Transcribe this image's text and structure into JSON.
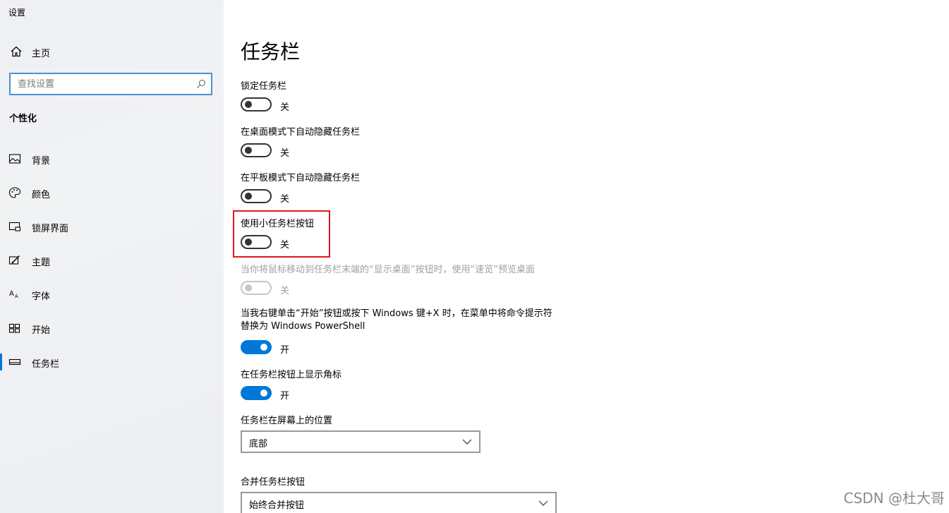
{
  "app": {
    "title": "设置"
  },
  "sidebar": {
    "home_label": "主页",
    "search_placeholder": "查找设置",
    "section_title": "个性化",
    "items": [
      {
        "label": "背景",
        "icon": "image-icon",
        "active": false
      },
      {
        "label": "颜色",
        "icon": "palette-icon",
        "active": false
      },
      {
        "label": "锁屏界面",
        "icon": "lock-screen-icon",
        "active": false
      },
      {
        "label": "主题",
        "icon": "theme-brush-icon",
        "active": false
      },
      {
        "label": "字体",
        "icon": "font-icon",
        "active": false
      },
      {
        "label": "开始",
        "icon": "start-grid-icon",
        "active": false
      },
      {
        "label": "任务栏",
        "icon": "taskbar-icon",
        "active": true
      }
    ]
  },
  "main": {
    "title": "任务栏",
    "settings": [
      {
        "label": "锁定任务栏",
        "state": "关",
        "on": false,
        "disabled": false
      },
      {
        "label": "在桌面模式下自动隐藏任务栏",
        "state": "关",
        "on": false,
        "disabled": false
      },
      {
        "label": "在平板模式下自动隐藏任务栏",
        "state": "关",
        "on": false,
        "disabled": false
      },
      {
        "label": "使用小任务栏按钮",
        "state": "关",
        "on": false,
        "disabled": false
      },
      {
        "label": "当你将鼠标移动到任务栏末端的“显示桌面”按钮时，使用“速览”预览桌面",
        "state": "关",
        "on": false,
        "disabled": true
      },
      {
        "label": "当我右键单击“开始”按钮或按下 Windows 键+X 时，在菜单中将命令提示符替换为 Windows PowerShell",
        "state": "开",
        "on": true,
        "disabled": false
      },
      {
        "label": "在任务栏按钮上显示角标",
        "state": "开",
        "on": true,
        "disabled": false
      }
    ],
    "position": {
      "label": "任务栏在屏幕上的位置",
      "value": "底部"
    },
    "combine": {
      "label": "合并任务栏按钮",
      "value": "始终合并按钮"
    }
  },
  "watermark": "CSDN @杜大哥",
  "colors": {
    "accent": "#0078d7",
    "highlight": "#e0191f",
    "sidebar_bg": "#eef0f3"
  }
}
